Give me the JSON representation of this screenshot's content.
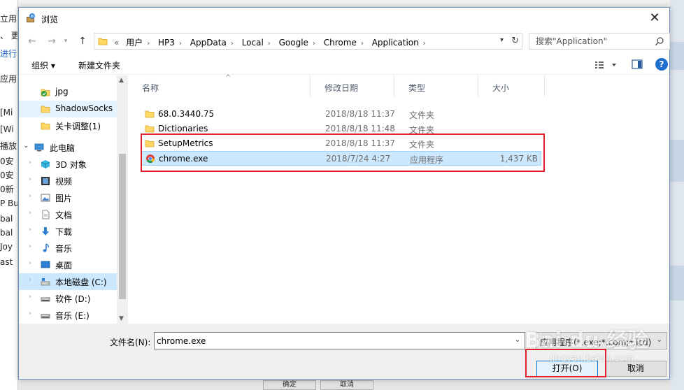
{
  "background": {
    "left_fragments": [
      "立用",
      "、   更",
      "进行",
      "应用",
      "[Mi",
      "[Wi",
      "播放",
      "0安",
      "0安",
      "0新",
      "P Bu",
      "bal",
      "bal",
      "Joy",
      "ast"
    ],
    "bottom_buttons": [
      "确定",
      "取消"
    ]
  },
  "dialog": {
    "title": "浏览",
    "close_symbol": "✕"
  },
  "address": {
    "crumbs_prefix": "«",
    "crumbs": [
      "用户",
      "HP3",
      "AppData",
      "Local",
      "Google",
      "Chrome",
      "Application"
    ],
    "search_placeholder": "搜索\"Application\""
  },
  "toolbar": {
    "organize_label": "组织 ▾",
    "new_folder_label": "新建文件夹",
    "help_symbol": "?"
  },
  "nav": {
    "items": [
      {
        "label": "jpg",
        "icon": "check-folder-icon"
      },
      {
        "label": "ShadowSocks",
        "icon": "folder-icon"
      },
      {
        "label": "关卡调整(1)",
        "icon": "folder-icon"
      },
      {
        "label": "此电脑",
        "icon": "computer-icon"
      },
      {
        "label": "3D 对象",
        "icon": "3d-objects-icon"
      },
      {
        "label": "视频",
        "icon": "video-icon"
      },
      {
        "label": "图片",
        "icon": "pictures-icon"
      },
      {
        "label": "文档",
        "icon": "documents-icon"
      },
      {
        "label": "下载",
        "icon": "download-icon"
      },
      {
        "label": "音乐",
        "icon": "music-icon"
      },
      {
        "label": "桌面",
        "icon": "desktop-icon"
      },
      {
        "label": "本地磁盘 (C:)",
        "icon": "drive-c-icon"
      },
      {
        "label": "软件 (D:)",
        "icon": "drive-icon"
      },
      {
        "label": "音乐 (E:)",
        "icon": "drive-icon"
      }
    ]
  },
  "list": {
    "columns": [
      "名称",
      "修改日期",
      "类型",
      "大小"
    ],
    "files": [
      {
        "name": "68.0.3440.75",
        "date": "2018/8/18 11:37",
        "type": "文件夹",
        "size": "",
        "icon": "folder-icon"
      },
      {
        "name": "Dictionaries",
        "date": "2018/8/18 11:48",
        "type": "文件夹",
        "size": "",
        "icon": "folder-icon"
      },
      {
        "name": "SetupMetrics",
        "date": "2018/8/18 11:37",
        "type": "文件夹",
        "size": "",
        "icon": "folder-icon"
      },
      {
        "name": "chrome.exe",
        "date": "2018/7/24 4:27",
        "type": "应用程序",
        "size": "1,437 KB",
        "icon": "chrome-icon"
      }
    ]
  },
  "bottom": {
    "filename_label": "文件名(N):",
    "filename_value": "chrome.exe",
    "filetype_label": "应用程序(*.exe;*.com;*.icd)",
    "open_label": "打开(O)",
    "cancel_label": "取消"
  },
  "watermark": {
    "brand": "Bai du 经验",
    "url": "jingyan.baidu.com"
  },
  "colors": {
    "accent": "#0078d7",
    "selection": "#cce8ff",
    "annotation": "#e0202c",
    "folder": "#ffd866"
  }
}
